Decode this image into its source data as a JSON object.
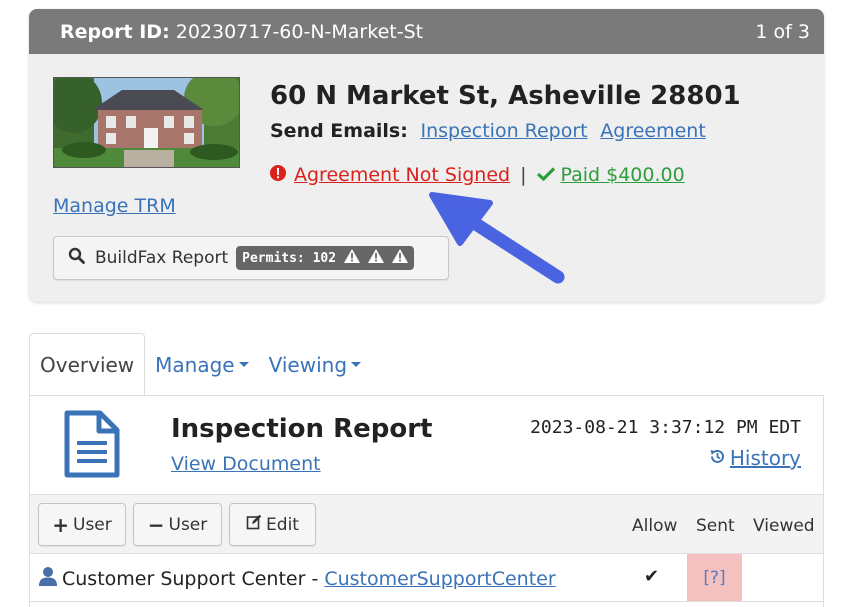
{
  "report": {
    "id_label": "Report ID:",
    "id_value": "20230717-60-N-Market-St",
    "pager": "1 of 3",
    "address": "60 N Market St, Asheville 28801",
    "send_emails_label": "Send Emails:",
    "link_inspection_report": "Inspection Report",
    "link_agreement": "Agreement",
    "agreement_status": "Agreement Not Signed",
    "separator": "|",
    "paid_status": "Paid $400.00",
    "manage_trm": "Manage TRM",
    "buildfax_label": "BuildFax Report",
    "permits_label": "Permits: 102"
  },
  "tabs": [
    {
      "label": "Overview",
      "active": true
    },
    {
      "label": "Manage",
      "dropdown": true
    },
    {
      "label": "Viewing",
      "dropdown": true
    }
  ],
  "document": {
    "title": "Inspection Report",
    "view_link": "View Document",
    "timestamp": "2023-08-21 3:37:12 PM EDT",
    "history": "History"
  },
  "toolbar": {
    "add_user": "User",
    "remove_user": "User",
    "edit": "Edit",
    "col_allow": "Allow",
    "col_sent": "Sent",
    "col_viewed": "Viewed"
  },
  "rows": [
    {
      "name": "Customer Support Center -",
      "link": "CustomerSupportCenter",
      "allow": "✔",
      "sent": "[?]"
    }
  ],
  "colors": {
    "header_bg": "#7a7a7a",
    "link": "#3a73b8",
    "error": "#d9221b",
    "success": "#2e9d3b",
    "arrow": "#4a63e0",
    "sent_highlight": "#f5c0c0"
  }
}
